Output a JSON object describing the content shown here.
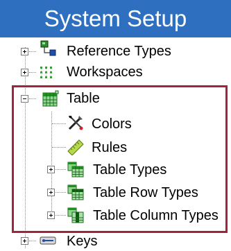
{
  "window": {
    "title": "System Setup"
  },
  "tree": {
    "items": [
      {
        "label": "Reference Types",
        "icon": "reference-types-icon",
        "expander": "plus"
      },
      {
        "label": "Workspaces",
        "icon": "workspaces-icon",
        "expander": "plus"
      },
      {
        "label": "Table",
        "icon": "table-icon",
        "expander": "minus",
        "children": [
          {
            "label": "Colors",
            "icon": "colors-tools-icon"
          },
          {
            "label": "Rules",
            "icon": "rules-ruler-icon"
          },
          {
            "label": "Table Types",
            "icon": "table-types-icon",
            "expander": "plus"
          },
          {
            "label": "Table Row Types",
            "icon": "table-row-types-icon",
            "expander": "plus"
          },
          {
            "label": "Table Column Types",
            "icon": "table-column-types-icon",
            "expander": "plus"
          }
        ]
      },
      {
        "label": "Keys",
        "icon": "keys-icon",
        "expander": "plus"
      }
    ]
  },
  "colors": {
    "title_bar": "#2e70bf",
    "highlight_border": "#a0243c",
    "table_icon_green": "#4caf50"
  }
}
